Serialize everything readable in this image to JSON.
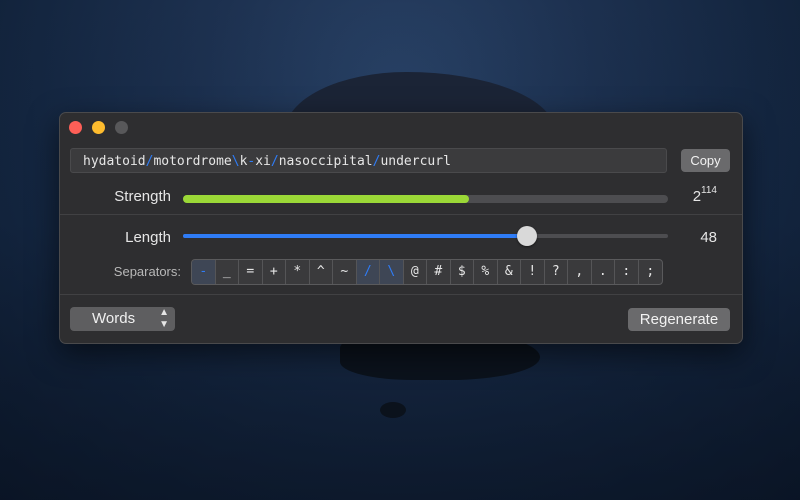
{
  "window": {
    "password_parts": [
      {
        "text": "hydatoid",
        "type": "word"
      },
      {
        "text": "/",
        "type": "sep"
      },
      {
        "text": "motordrome",
        "type": "word"
      },
      {
        "text": "\\",
        "type": "sep"
      },
      {
        "text": "k",
        "type": "word"
      },
      {
        "text": "-",
        "type": "sep"
      },
      {
        "text": "xi",
        "type": "word"
      },
      {
        "text": "/",
        "type": "sep"
      },
      {
        "text": "nasoccipital",
        "type": "word"
      },
      {
        "text": "/",
        "type": "sep"
      },
      {
        "text": "undercurl",
        "type": "word"
      }
    ],
    "copy_label": "Copy",
    "strength_label": "Strength",
    "strength_base": "2",
    "strength_exponent": "114",
    "strength_fraction": 0.59,
    "length_label": "Length",
    "length_value": "48",
    "length_fraction": 0.71,
    "separators_label": "Separators:",
    "separators": [
      {
        "char": "-",
        "on": true
      },
      {
        "char": "_",
        "on": false
      },
      {
        "char": "=",
        "on": false
      },
      {
        "char": "+",
        "on": false
      },
      {
        "char": "*",
        "on": false
      },
      {
        "char": "^",
        "on": false
      },
      {
        "char": "~",
        "on": false
      },
      {
        "char": "/",
        "on": true
      },
      {
        "char": "\\",
        "on": true
      },
      {
        "char": "@",
        "on": false
      },
      {
        "char": "#",
        "on": false
      },
      {
        "char": "$",
        "on": false
      },
      {
        "char": "%",
        "on": false
      },
      {
        "char": "&",
        "on": false
      },
      {
        "char": "!",
        "on": false
      },
      {
        "char": "?",
        "on": false
      },
      {
        "char": ",",
        "on": false
      },
      {
        "char": ".",
        "on": false
      },
      {
        "char": ":",
        "on": false
      },
      {
        "char": ";",
        "on": false
      }
    ],
    "mode_value": "Words",
    "regenerate_label": "Regenerate"
  },
  "colors": {
    "accent": "#2f7cf6",
    "strength_fill": "#9bd837",
    "window_bg": "#2e2e30"
  },
  "icons": {
    "mode_chevron": "chevron-up-down-icon"
  }
}
